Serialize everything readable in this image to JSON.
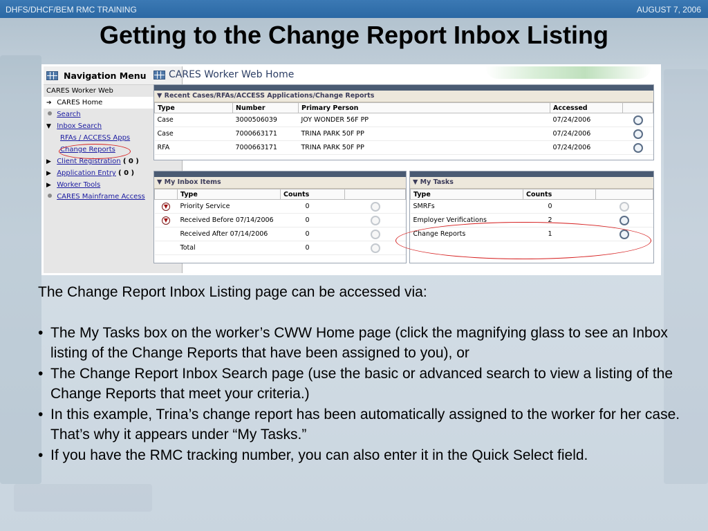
{
  "header": {
    "left_text": "DHFS/DHCF/BEM  RMC TRAINING",
    "right_text": "AUGUST 7, 2006"
  },
  "slide_title": "Getting to the Change Report Inbox Listing",
  "screenshot": {
    "nav": {
      "title": "Navigation Menu",
      "items": [
        {
          "label": "CARES Worker Web",
          "style": "plain"
        },
        {
          "label": "CARES Home",
          "style": "current"
        },
        {
          "label": "Search",
          "style": "link"
        },
        {
          "label": "Inbox Search",
          "style": "link"
        },
        {
          "label": "RFAs / ACCESS Apps",
          "style": "sublink"
        },
        {
          "label": "Change Reports",
          "style": "sublink"
        },
        {
          "label": "Client Registration",
          "count": "( 0 )",
          "style": "link"
        },
        {
          "label": "Application Entry",
          "count": "( 0 )",
          "style": "link"
        },
        {
          "label": "Worker Tools",
          "style": "link"
        },
        {
          "label": "CARES Mainframe Access",
          "style": "link"
        }
      ]
    },
    "page_title": "CARES Worker Web Home",
    "recent": {
      "heading": "Recent Cases/RFAs/ACCESS Applications/Change Reports",
      "columns": [
        "Type",
        "Number",
        "Primary Person",
        "Accessed"
      ],
      "rows": [
        {
          "type": "Case",
          "number": "3000506039",
          "person": "JOY WONDER 56F PP",
          "accessed": "07/24/2006"
        },
        {
          "type": "Case",
          "number": "7000663171",
          "person": "TRINA PARK 50F PP",
          "accessed": "07/24/2006"
        },
        {
          "type": "RFA",
          "number": "7000663171",
          "person": "TRINA PARK 50F PP",
          "accessed": "07/24/2006"
        }
      ]
    },
    "inbox": {
      "heading": "My Inbox Items",
      "columns": [
        "Type",
        "Counts"
      ],
      "rows": [
        {
          "type": "Priority Service",
          "count": "0",
          "flag": true
        },
        {
          "type": "Received Before 07/14/2006",
          "count": "0",
          "flag": true
        },
        {
          "type": "Received After 07/14/2006",
          "count": "0",
          "flag": false
        },
        {
          "type": "Total",
          "count": "0",
          "flag": false
        }
      ]
    },
    "tasks": {
      "heading": "My Tasks",
      "columns": [
        "Type",
        "Counts"
      ],
      "rows": [
        {
          "type": "SMRFs",
          "count": "0"
        },
        {
          "type": "Employer Verifications",
          "count": "2"
        },
        {
          "type": "Change Reports",
          "count": "1"
        }
      ]
    }
  },
  "body": {
    "intro": "The Change Report Inbox Listing page can be accessed via:",
    "bullets": [
      "The My Tasks box on the worker’s CWW Home page (click the magnifying glass to see an Inbox listing of the Change Reports that have been assigned to you), or",
      "The Change Report Inbox Search page (use the basic or advanced search to view a listing of the Change Reports that meet your criteria.)",
      "In this example, Trina’s change report has been automatically assigned to the worker for her case.  That’s why it appears under “My Tasks.”",
      "If you have the RMC tracking number, you can also enter it in the Quick Select field."
    ]
  },
  "colors": {
    "header_bar": "#2f6ea9",
    "highlight_ellipse": "#d62020",
    "panel_bar": "#4a5b73"
  }
}
